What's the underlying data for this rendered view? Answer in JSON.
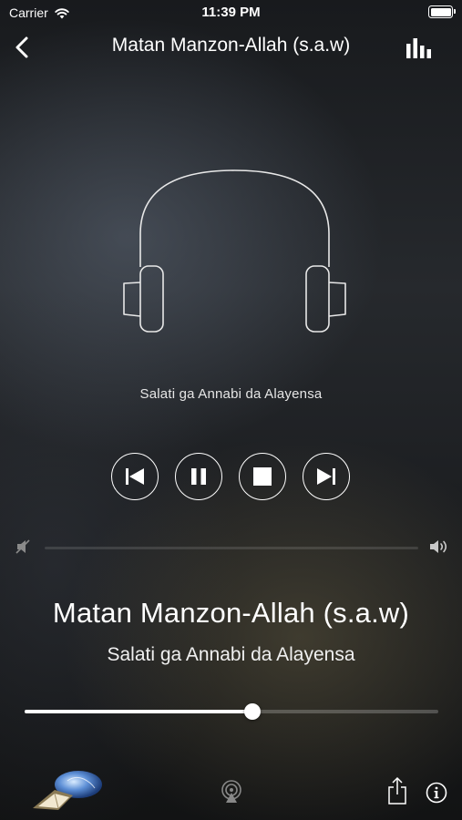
{
  "status_bar": {
    "carrier": "Carrier",
    "time": "11:39 PM",
    "battery_level": 1.0
  },
  "nav": {
    "title": "Matan Manzon-Allah (s.a.w)",
    "back_icon": "chevron-left-icon",
    "equalizer_icon": "equalizer-icon"
  },
  "artwork": {
    "icon": "headphones-icon",
    "subtitle": "Salati ga Annabi da Alayensa"
  },
  "controls": [
    "previous-track",
    "pause",
    "stop",
    "next-track"
  ],
  "volume": {
    "level": 0.0
  },
  "now_playing": {
    "title": "Matan Manzon-Allah (s.a.w)",
    "artist": "Salati ga Annabi da Alayensa"
  },
  "progress": {
    "fraction": 0.55
  },
  "toolbar": [
    "app-logo",
    "airplay-icon",
    "share-icon",
    "info-icon"
  ]
}
